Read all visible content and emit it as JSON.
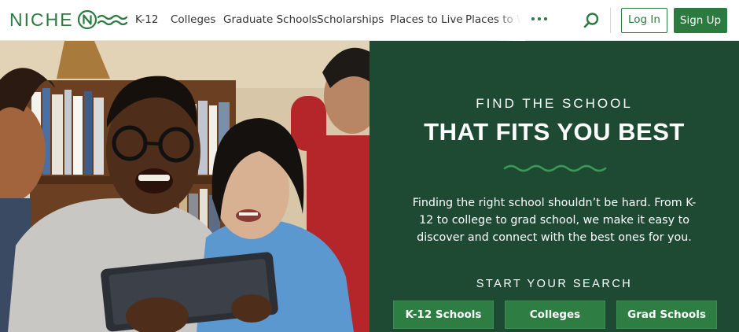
{
  "brand": {
    "name": "NICHE",
    "primary_color": "#2b7a3f",
    "panel_color": "#1e4a33"
  },
  "nav": {
    "items": [
      {
        "label": "K-12"
      },
      {
        "label": "Colleges"
      },
      {
        "label": "Graduate Schools"
      },
      {
        "label": "Scholarships"
      },
      {
        "label": "Places to Live"
      },
      {
        "label": "Places to Work"
      }
    ],
    "more_icon": "more-dots-icon",
    "search_icon": "search-icon"
  },
  "auth": {
    "login_label": "Log In",
    "signup_label": "Sign Up"
  },
  "hero": {
    "eyebrow": "FIND THE SCHOOL",
    "headline": "THAT FITS YOU BEST",
    "description": "Finding the right school shouldn’t be hard. From K-12 to college to grad school, we make it easy to discover and connect with the best ones for you.",
    "start_label": "START YOUR SEARCH",
    "buttons": [
      {
        "label": "K-12 Schools"
      },
      {
        "label": "Colleges"
      },
      {
        "label": "Grad Schools"
      }
    ]
  }
}
